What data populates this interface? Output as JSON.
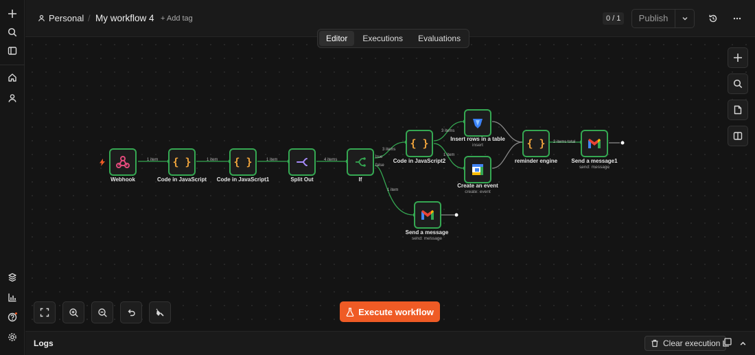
{
  "breadcrumb": {
    "project": "Personal",
    "workflow_name": "My workflow 4",
    "add_tag": "+ Add tag"
  },
  "header": {
    "counter": "0 / 1",
    "publish_label": "Publish"
  },
  "tabs": [
    {
      "label": "Editor",
      "active": true
    },
    {
      "label": "Executions",
      "active": false
    },
    {
      "label": "Evaluations",
      "active": false
    }
  ],
  "nodes": {
    "webhook": {
      "label": "Webhook",
      "icon": "webhook-icon"
    },
    "code1": {
      "label": "Code in JavaScript",
      "icon": "code-braces-icon"
    },
    "code2": {
      "label": "Code in JavaScript1",
      "icon": "code-braces-icon"
    },
    "split": {
      "label": "Split Out",
      "icon": "split-arrows-icon"
    },
    "if": {
      "label": "If",
      "icon": "branch-icon"
    },
    "code3": {
      "label": "Code in JavaScript2",
      "icon": "code-braces-icon"
    },
    "insert": {
      "label": "Insert rows in a table",
      "sub": "insert",
      "icon": "database-icon"
    },
    "event": {
      "label": "Create an event",
      "sub": "create: event",
      "icon": "calendar-icon"
    },
    "reminder": {
      "label": "reminder engine",
      "icon": "code-braces-icon"
    },
    "send1": {
      "label": "Send a message1",
      "sub": "send: message",
      "icon": "gmail-icon"
    },
    "send": {
      "label": "Send a message",
      "sub": "send: message",
      "icon": "gmail-icon"
    }
  },
  "edges": {
    "e1": "1 item",
    "e2": "1 item",
    "e3": "1 item",
    "e4": "4 items",
    "e5": "3 items",
    "e6": "3 items",
    "e7": "1 item",
    "e8": "2 items total",
    "e9": "1 item",
    "true_out": "true",
    "false_out": "false"
  },
  "execute_label": "Execute workflow",
  "logs": {
    "title": "Logs",
    "clear_label": "Clear execution"
  },
  "colors": {
    "accent": "#ef5b25",
    "node_border": "#35a852",
    "edge": "#35a852",
    "background": "#141414"
  }
}
